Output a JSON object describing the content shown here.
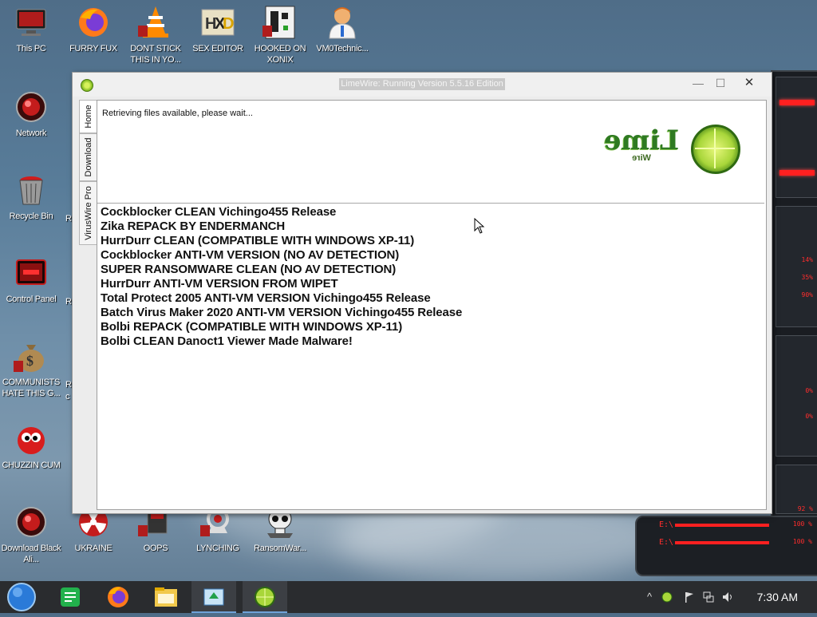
{
  "desktop": {
    "icons": [
      {
        "label": "This PC",
        "icon": "computer-icon"
      },
      {
        "label": "FURRY FUX",
        "icon": "firefox-icon"
      },
      {
        "label": "DONT STICK THIS IN YO...",
        "icon": "vlc-cone-icon"
      },
      {
        "label": "SEX EDITOR",
        "icon": "hxd-icon"
      },
      {
        "label": "HOOKED ON XONIX",
        "icon": "game-icon"
      },
      {
        "label": "VM0Technic...",
        "icon": "doctor-icon"
      },
      {
        "label": "Network",
        "icon": "network-icon"
      },
      {
        "label": "Recycle Bin",
        "icon": "recycle-bin-icon"
      },
      {
        "label": "Control Panel",
        "icon": "control-panel-icon"
      },
      {
        "label": "COMMUNISTS HATE THIS G...",
        "icon": "money-bag-icon"
      },
      {
        "label": "CHUZZIN CUM",
        "icon": "chuzzle-icon"
      },
      {
        "label": "Download Black Ali...",
        "icon": "download-icon"
      },
      {
        "label": "UKRAINE",
        "icon": "radiation-icon"
      },
      {
        "label": "OOPS",
        "icon": "oops-icon"
      },
      {
        "label": "LYNCHING",
        "icon": "lynching-icon"
      },
      {
        "label": "RansomWar...",
        "icon": "skull-icon"
      }
    ],
    "partial_labels": [
      "R",
      "R",
      "R",
      "c"
    ]
  },
  "gadget": {
    "readouts": [
      "14%",
      "35%",
      "90%",
      "0%",
      "0%",
      "92 %",
      "100 %",
      "100 %"
    ],
    "labels": [
      "E:\\",
      "E:\\"
    ]
  },
  "window": {
    "title": "LimeWire: Running Version 5.5.16 Edition",
    "controls": {
      "minimize": "—",
      "maximize": "☐",
      "close": "✕"
    },
    "tabs": [
      "Home",
      "Download",
      "VirusWire Pro"
    ],
    "status_text": "Retrieving files available, please wait...",
    "logo": {
      "text": "Lime",
      "subtext": "Wire"
    },
    "files": [
      "Cockblocker CLEAN Vichingo455 Release",
      "Zika REPACK BY ENDERMANCH",
      "HurrDurr CLEAN (COMPATIBLE WITH WINDOWS XP-11)",
      "Cockblocker ANTI-VM VERSION (NO AV DETECTION)",
      "SUPER RANSOMWARE CLEAN (NO AV DETECTION)",
      "HurrDurr ANTI-VM VERSION FROM WIPET",
      "Total Protect 2005 ANTI-VM VERSION Vichingo455 Release",
      "Batch Virus Maker 2020 ANTI-VM VERSION Vichingo455 Release",
      "Bolbi REPACK (COMPATIBLE WITH WINDOWS XP-11)",
      "Bolbi CLEAN Danoct1 Viewer Made Malware!"
    ]
  },
  "taskbar": {
    "apps": [
      "start-icon",
      "notes-icon",
      "firefox-icon",
      "file-explorer-icon",
      "app-window-icon",
      "limewire-icon"
    ],
    "tray": [
      "limewire-tray-icon",
      "chevron-up-icon",
      "flag-icon",
      "network-icon",
      "volume-icon"
    ],
    "clock": "7:30 AM"
  },
  "colors": {
    "gadget_red": "#ff2020",
    "limewire_green": "#2f7a22",
    "taskbar": "#2a2c2f"
  }
}
